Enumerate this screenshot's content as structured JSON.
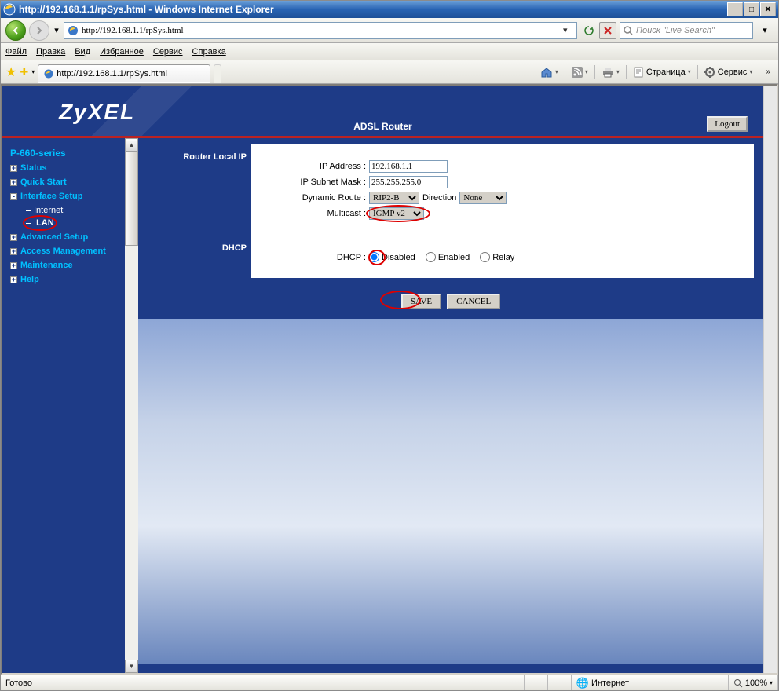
{
  "window": {
    "title": "http://192.168.1.1/rpSys.html - Windows Internet Explorer",
    "url": "http://192.168.1.1/rpSys.html",
    "search_placeholder": "Поиск \"Live Search\""
  },
  "menu": {
    "file": "Файл",
    "edit": "Правка",
    "view": "Вид",
    "favorites": "Избранное",
    "tools": "Сервис",
    "help": "Справка"
  },
  "tab": {
    "title": "http://192.168.1.1/rpSys.html"
  },
  "right_tools": {
    "page": "Страница",
    "service": "Сервис"
  },
  "router": {
    "logo": "ZyXEL",
    "title": "ADSL Router",
    "logout": "Logout"
  },
  "sidebar": {
    "series": "P-660-series",
    "items": [
      "Status",
      "Quick Start",
      "Interface Setup",
      "Advanced Setup",
      "Access Management",
      "Maintenance",
      "Help"
    ],
    "sub_internet": "Internet",
    "sub_lan": "LAN"
  },
  "form": {
    "section_local_ip": "Router Local IP",
    "section_dhcp": "DHCP",
    "ip_address_label": "IP Address :",
    "ip_address_value": "192.168.1.1",
    "subnet_label": "IP Subnet Mask :",
    "subnet_value": "255.255.255.0",
    "dynroute_label": "Dynamic Route :",
    "dynroute_value": "RIP2-B",
    "direction_label": "Direction",
    "direction_value": "None",
    "multicast_label": "Multicast :",
    "multicast_value": "IGMP v2",
    "dhcp_label": "DHCP :",
    "dhcp_disabled": "Disabled",
    "dhcp_enabled": "Enabled",
    "dhcp_relay": "Relay",
    "save": "SAVE",
    "cancel": "CANCEL"
  },
  "status": {
    "ready": "Готово",
    "zone": "Интернет",
    "zoom": "100%"
  }
}
